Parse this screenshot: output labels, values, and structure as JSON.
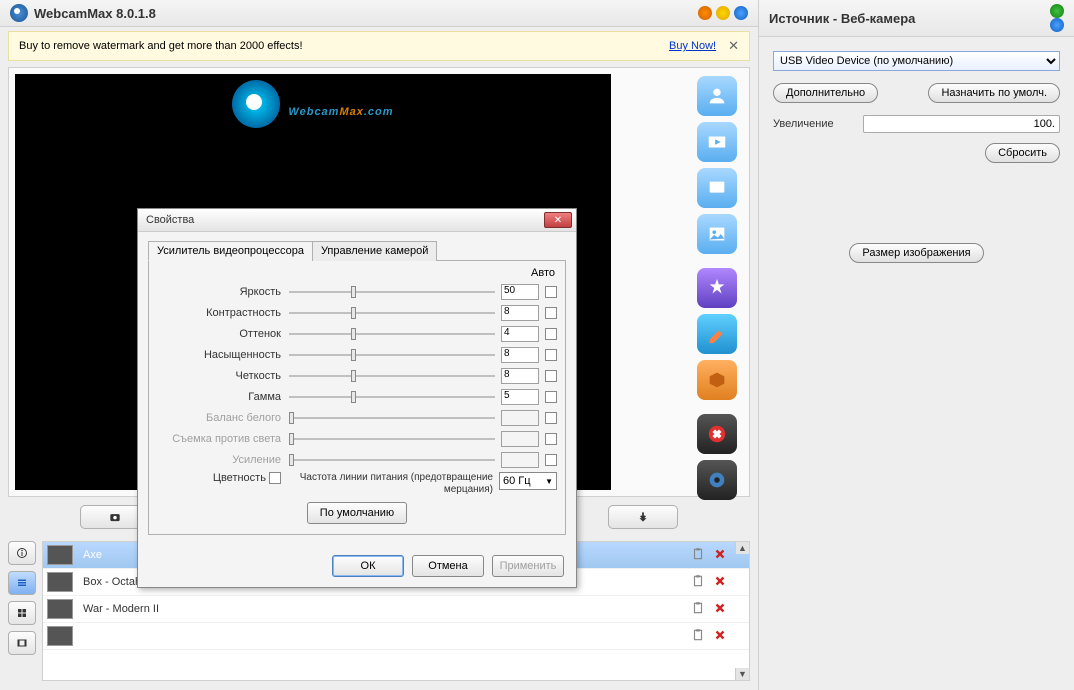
{
  "header": {
    "title": "WebcamMax  8.0.1.8"
  },
  "promo": {
    "text": "Buy to remove watermark and get more than 2000 effects!",
    "link_label": "Buy Now!"
  },
  "watermark": {
    "part1": "Webcam",
    "part2": "Max",
    "suffix": ".com"
  },
  "right_panel": {
    "title": "Источник - Веб-камера",
    "device": "USB Video Device (по умолчанию)",
    "adv_btn": "Дополнительно",
    "default_btn": "Назначить по умолч.",
    "zoom_label": "Увеличение",
    "zoom_value": "100.",
    "reset_btn": "Сбросить",
    "size_btn": "Размер изображения"
  },
  "effects": [
    {
      "name": "Axe",
      "selected": true
    },
    {
      "name": "Box - Octahedral",
      "selected": false
    },
    {
      "name": "War - Modern II",
      "selected": false
    },
    {
      "name": "",
      "selected": false
    }
  ],
  "dialog": {
    "title": "Свойства",
    "tab1": "Усилитель видеопроцессора",
    "tab2": "Управление камерой",
    "auto_label": "Авто",
    "rows": [
      {
        "label": "Яркость",
        "value": "50",
        "pos": 30,
        "disabled": false
      },
      {
        "label": "Контрастность",
        "value": "8",
        "pos": 30,
        "disabled": false
      },
      {
        "label": "Оттенок",
        "value": "4",
        "pos": 30,
        "disabled": false
      },
      {
        "label": "Насыщенность",
        "value": "8",
        "pos": 30,
        "disabled": false
      },
      {
        "label": "Четкость",
        "value": "8",
        "pos": 30,
        "disabled": false
      },
      {
        "label": "Гамма",
        "value": "5",
        "pos": 30,
        "disabled": false
      },
      {
        "label": "Баланс белого",
        "value": "",
        "pos": 0,
        "disabled": true
      },
      {
        "label": "Съемка против света",
        "value": "",
        "pos": 0,
        "disabled": true
      },
      {
        "label": "Усиление",
        "value": "",
        "pos": 0,
        "disabled": true
      }
    ],
    "color_enable": "Цветность",
    "freq_label": "Частота линии питания (предотвращение мерцания)",
    "freq_value": "60 Гц",
    "default_btn": "По умолчанию",
    "ok_btn": "ОК",
    "cancel_btn": "Отмена",
    "apply_btn": "Применить"
  }
}
